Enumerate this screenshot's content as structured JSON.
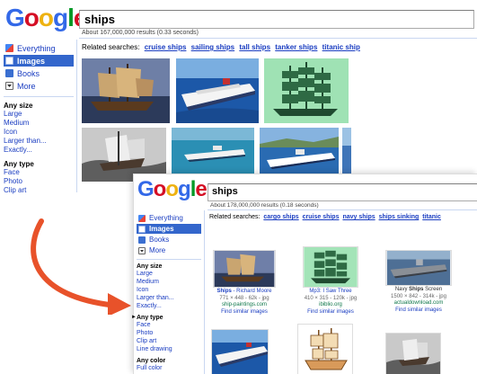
{
  "screen1": {
    "logo": [
      "G",
      "o",
      "o",
      "g",
      "l",
      "e"
    ],
    "search_value": "ships",
    "stats": "About 167,000,000 results (0.33 seconds)",
    "sidebar": {
      "items": [
        {
          "label": "Everything",
          "icon": "everything-icon",
          "selected": false
        },
        {
          "label": "Images",
          "icon": "images-icon",
          "selected": true
        },
        {
          "label": "Books",
          "icon": "books-icon",
          "selected": false
        },
        {
          "label": "More",
          "icon": "more-icon",
          "selected": false
        }
      ],
      "size_heading": "Any size",
      "size_links": [
        "Large",
        "Medium",
        "Icon",
        "Larger than...",
        "Exactly..."
      ],
      "type_heading": "Any type",
      "type_links": [
        "Face",
        "Photo",
        "Clip art"
      ]
    },
    "related_label": "Related searches:",
    "related": [
      "cruise ships",
      "sailing ships",
      "tall ships",
      "tanker ships",
      "titanic ship"
    ]
  },
  "screen2": {
    "logo": [
      "G",
      "o",
      "o",
      "g",
      "l",
      "e"
    ],
    "search_value": "ships",
    "stats": "About 178,000,000 results (0.18 seconds)",
    "sidebar": {
      "items": [
        {
          "label": "Everything",
          "icon": "everything-icon",
          "selected": false
        },
        {
          "label": "Images",
          "icon": "images-icon",
          "selected": true
        },
        {
          "label": "Books",
          "icon": "books-icon",
          "selected": false
        },
        {
          "label": "More",
          "icon": "more-icon",
          "selected": false
        }
      ],
      "size_heading": "Any size",
      "size_links": [
        "Large",
        "Medium",
        "Icon",
        "Larger than...",
        "Exactly..."
      ],
      "type_heading": "Any type",
      "type_links": [
        "Face",
        "Photo",
        "Clip art",
        "Line drawing"
      ],
      "color_heading": "Any color",
      "color_links": [
        "Full color"
      ]
    },
    "related_label": "Related searches:",
    "related": [
      "cargo ships",
      "cruise ships",
      "navy ships",
      "ships sinking",
      "titanic"
    ],
    "results": [
      {
        "title_pre": "",
        "title_bold": "Ships",
        "title_post": " - Richard Moore",
        "meta": "771 × 448 - 62k - jpg",
        "source": "ship-paintings.com",
        "similar": "Find similar images"
      },
      {
        "title_pre": "Mp3: I Saw Three",
        "title_bold": "",
        "title_post": "",
        "meta": "410 × 315 - 120k - jpg",
        "source": "ibiblio.org",
        "similar": "Find similar images"
      },
      {
        "title_pre": "Navy ",
        "title_bold": "Ships",
        "title_post": " Screen",
        "meta": "1500 × 842 - 314k - jpg",
        "source": "actualdownload.com",
        "similar": "Find similar images"
      }
    ]
  },
  "colors": {
    "google_blue": "#3366cc",
    "link": "#1a3dc1",
    "url_green": "#0e774a",
    "arrow": "#e8522a"
  }
}
